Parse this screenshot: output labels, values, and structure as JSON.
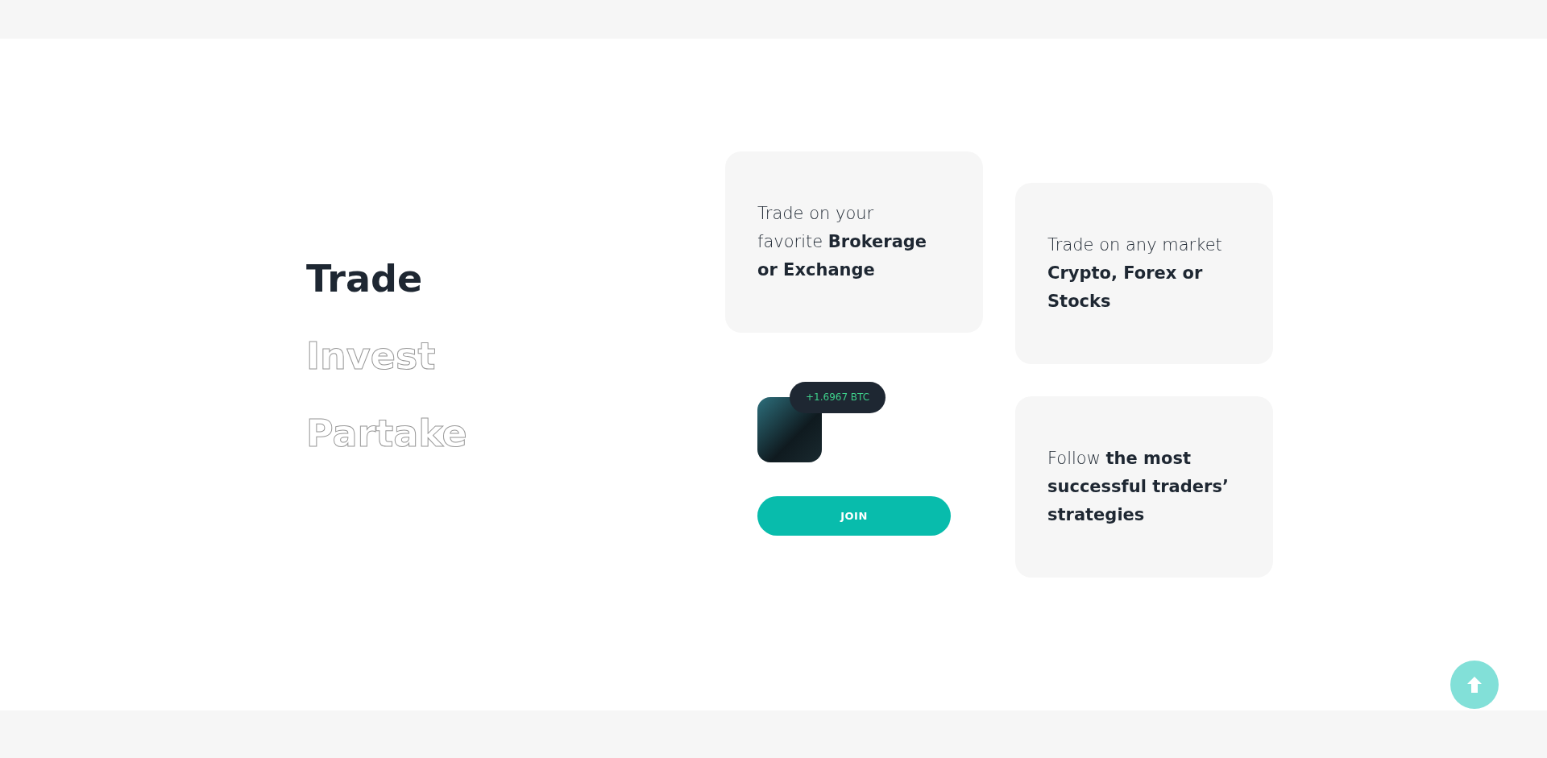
{
  "tabs": [
    {
      "label": "Trade",
      "selected": true
    },
    {
      "label": "Invest",
      "selected": false
    },
    {
      "label": "Partake",
      "selected": false
    }
  ],
  "cards": [
    {
      "text": "Trade on your favorite **Brokerage or Exchange**"
    },
    {
      "text": "Trade on any market **Crypto, Forex or Stocks**"
    },
    {
      "text": "Follow **the most successful traders’ strategies**"
    }
  ],
  "badge": "+1.6967 BTC",
  "join_button": "JOIN"
}
